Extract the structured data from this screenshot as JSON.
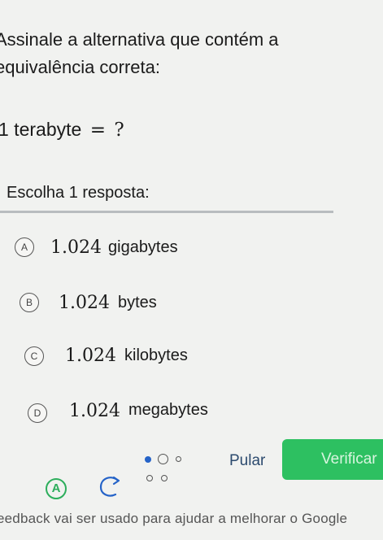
{
  "prompt": {
    "line1": "Assinale a alternativa que contém a",
    "line2": "equivalência correta:"
  },
  "question": {
    "lhs": "1 terabyte",
    "equals": "=",
    "rhs": "?"
  },
  "instruction": "Escolha 1 resposta:",
  "options": [
    {
      "letter": "A",
      "number": "1.024",
      "unit": "gigabytes"
    },
    {
      "letter": "B",
      "number": "1.024",
      "unit": "bytes"
    },
    {
      "letter": "C",
      "number": "1.024",
      "unit": "kilobytes"
    },
    {
      "letter": "D",
      "number": "1.024",
      "unit": "megabytes"
    }
  ],
  "footer_bar": {
    "skip_label": "Pular",
    "verify_label": "Verificar",
    "hint_icon": "A",
    "retry_icon": "undo-icon"
  },
  "footer_text": "eedback vai ser usado para ajudar a melhorar o Google",
  "colors": {
    "background": "#f1f2f0",
    "verify_button": "#2dc061",
    "skip_text": "#2c4a6e",
    "progress_dot": "#2563c8"
  }
}
